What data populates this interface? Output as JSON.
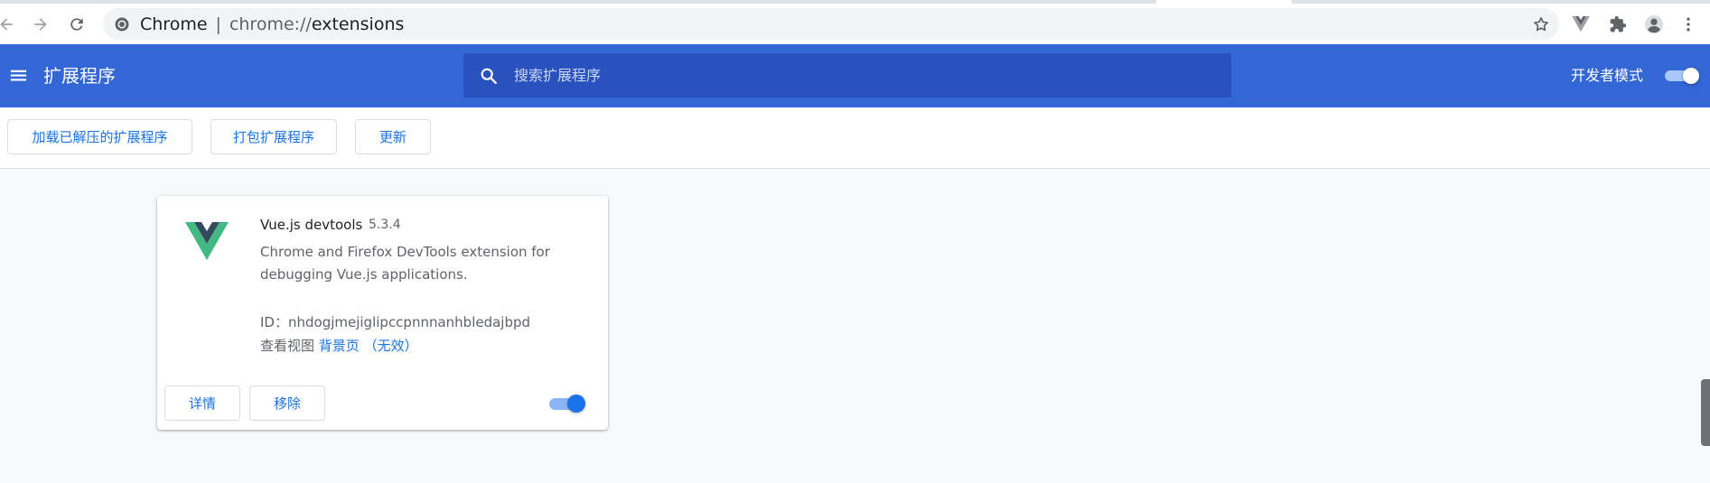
{
  "browser": {
    "site_label": "Chrome",
    "url_scheme": "chrome://",
    "url_path": "extensions"
  },
  "header": {
    "title": "扩展程序",
    "search_placeholder": "搜索扩展程序",
    "dev_mode_label": "开发者模式",
    "dev_mode_enabled": true
  },
  "toolbar": {
    "load_unpacked_label": "加载已解压的扩展程序",
    "pack_label": "打包扩展程序",
    "update_label": "更新"
  },
  "extension": {
    "name": "Vue.js devtools",
    "version": "5.3.4",
    "description": "Chrome and Firefox DevTools extension for debugging Vue.js applications.",
    "id_label": "ID：",
    "id_value": "nhdogjmejiglipccpnnnanhbledajbpd",
    "views_label": "查看视图",
    "views_link": "背景页",
    "views_status": "（无效）",
    "details_label": "详情",
    "remove_label": "移除",
    "enabled": true
  },
  "colors": {
    "header_bg": "#3367d6",
    "search_bg": "#2a52be",
    "accent": "#1a73e8",
    "vue_green": "#42b883",
    "vue_dark": "#35495e"
  }
}
